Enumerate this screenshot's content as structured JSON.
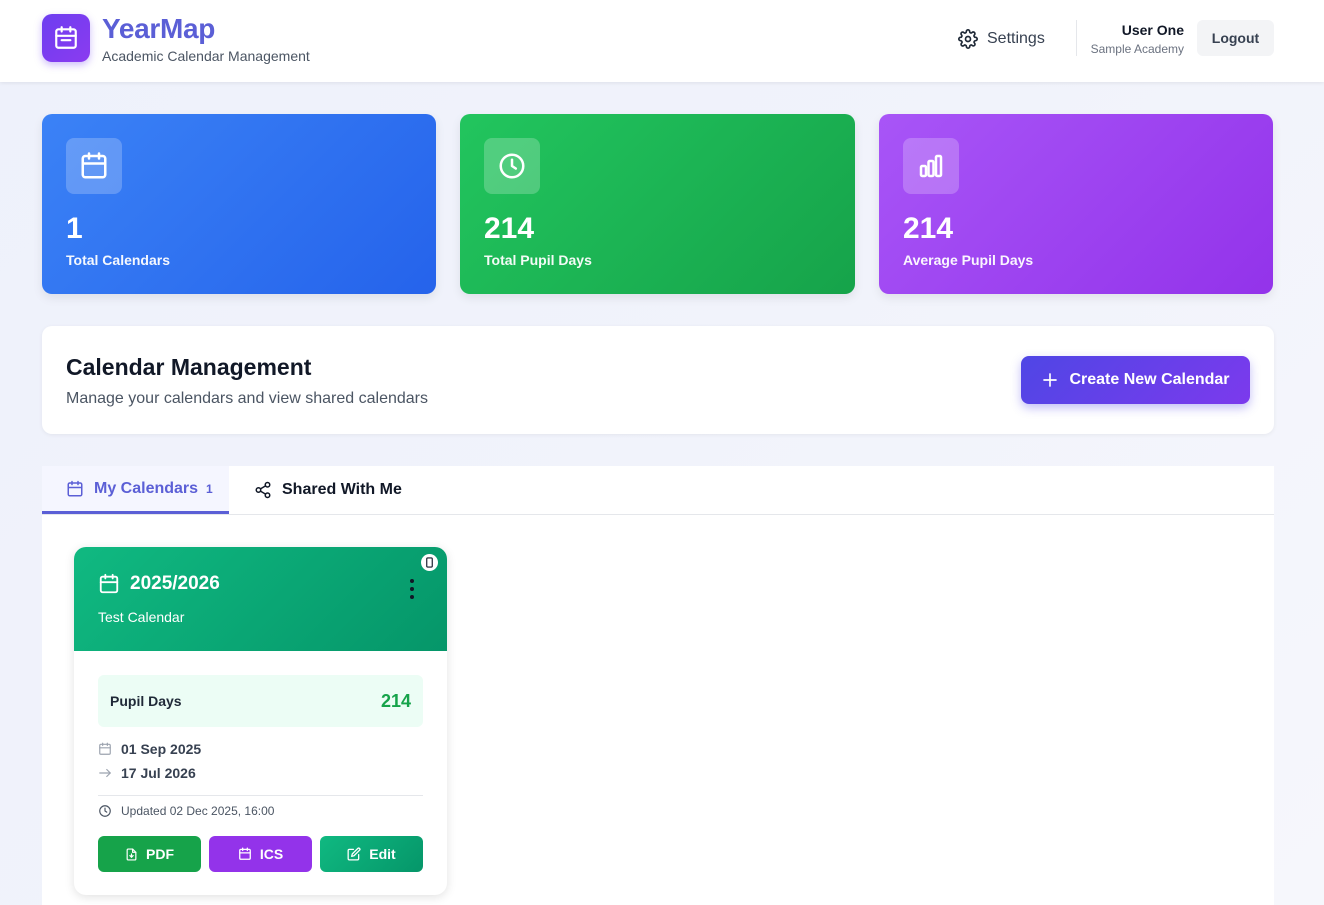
{
  "header": {
    "app_title": "YearMap",
    "app_subtitle": "Academic Calendar Management",
    "settings_label": "Settings",
    "user_name": "User One",
    "user_org": "Sample Academy",
    "logout_label": "Logout"
  },
  "stats": [
    {
      "value": "1",
      "label": "Total Calendars",
      "icon": "calendar-icon",
      "color": "#3b82f6"
    },
    {
      "value": "214",
      "label": "Total Pupil Days",
      "icon": "clock-icon",
      "color": "#22c55e"
    },
    {
      "value": "214",
      "label": "Average Pupil Days",
      "icon": "bar-chart-icon",
      "color": "#a855f7"
    }
  ],
  "management": {
    "title": "Calendar Management",
    "subtitle": "Manage your calendars and view shared calendars",
    "create_button": "Create New Calendar"
  },
  "tabs": [
    {
      "label": "My Calendars",
      "count": "1",
      "active": true,
      "icon": "calendar-icon"
    },
    {
      "label": "Shared With Me",
      "active": false,
      "icon": "share-icon"
    }
  ],
  "calendar_card": {
    "title": "2025/2026",
    "subtitle": "Test Calendar",
    "pupil_days_label": "Pupil Days",
    "pupil_days_value": "214",
    "start_date": "01 Sep 2025",
    "end_date": "17 Jul 2026",
    "updated": "Updated 02 Dec 2025, 16:00",
    "buttons": {
      "pdf": "PDF",
      "ics": "ICS",
      "edit": "Edit"
    },
    "header_color": "#10b981"
  },
  "colors": {
    "accent": "#5b5fd6",
    "primary_button": "#4f46e5",
    "green": "#16a34a",
    "purple": "#9333ea"
  }
}
